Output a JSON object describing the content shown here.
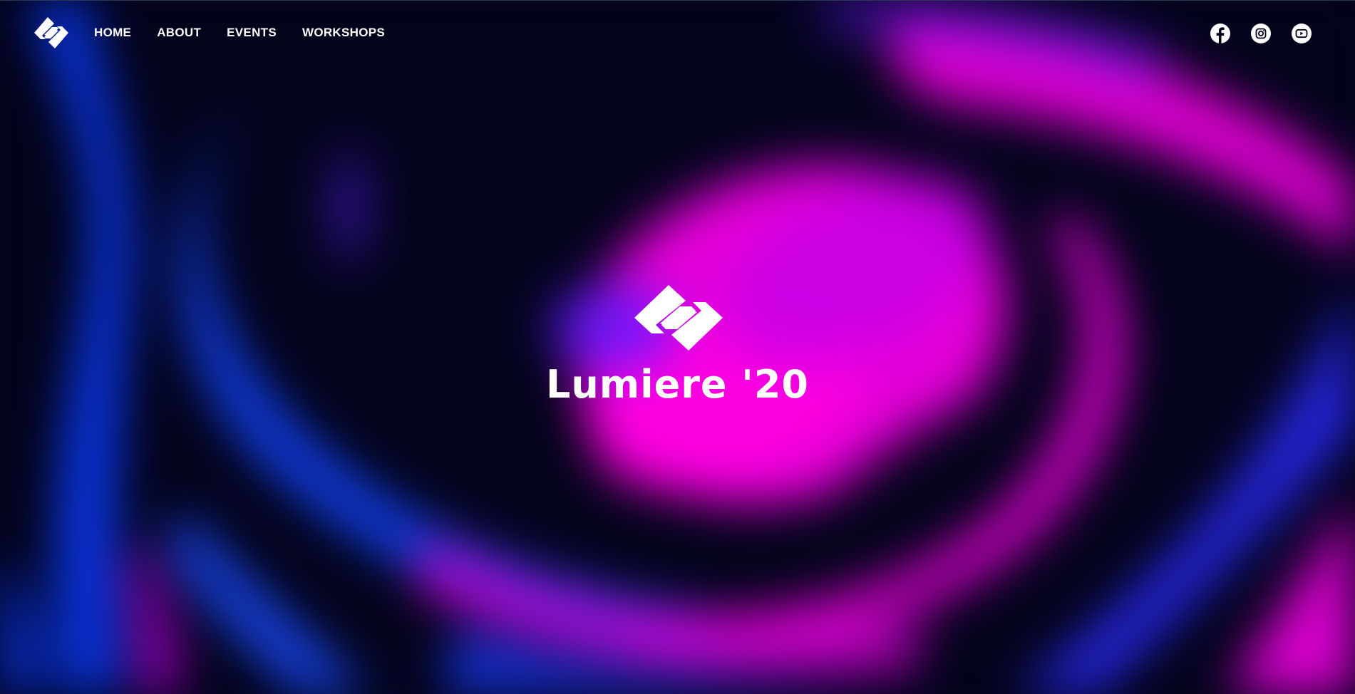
{
  "colors": {
    "background": "#03031c",
    "magenta": "#ff00e0",
    "blue": "#0a3cff",
    "violet": "#5a1bff",
    "text": "#ffffff"
  },
  "header": {
    "logo_icon": "lumiere-diamond-logo-icon",
    "nav": [
      {
        "label": "HOME"
      },
      {
        "label": "ABOUT"
      },
      {
        "label": "EVENTS"
      },
      {
        "label": "WORKSHOPS"
      }
    ],
    "social": [
      {
        "icon": "facebook-icon"
      },
      {
        "icon": "instagram-icon"
      },
      {
        "icon": "youtube-icon"
      }
    ]
  },
  "hero": {
    "logo_icon": "lumiere-diamond-logo-icon",
    "title": "Lumiere '20"
  }
}
